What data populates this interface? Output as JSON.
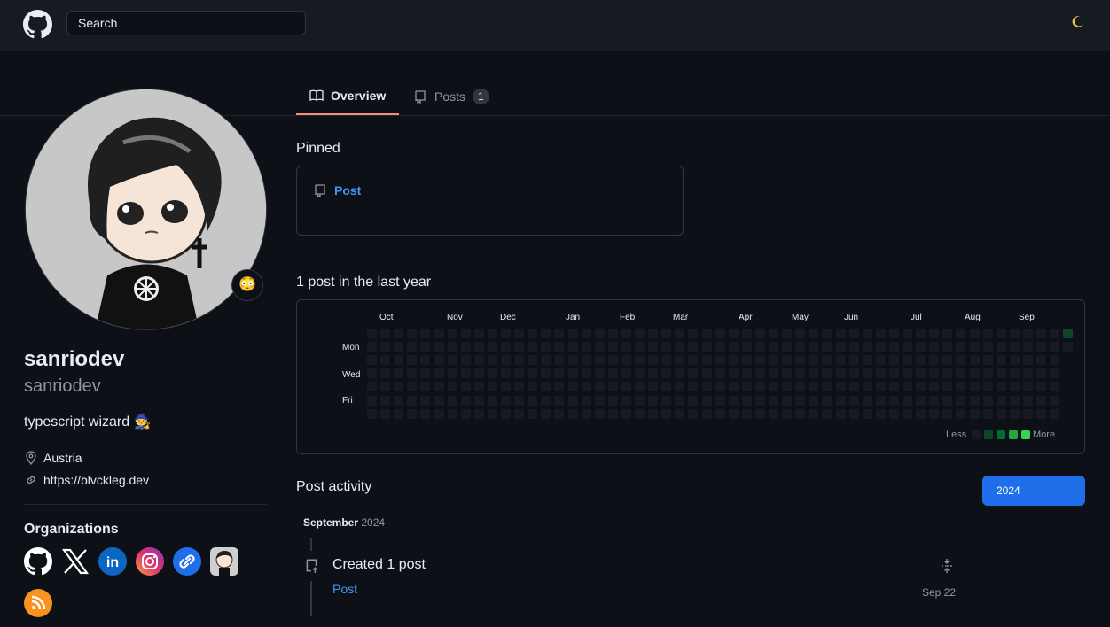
{
  "header": {
    "search_placeholder": "Search",
    "logo_icon": "github-mark-icon",
    "theme_icon": "moon-icon"
  },
  "tabs": [
    {
      "label": "Overview",
      "icon": "book-icon",
      "active": true
    },
    {
      "label": "Posts",
      "icon": "repo-icon",
      "count": "1",
      "active": false
    }
  ],
  "profile": {
    "name": "sanriodev",
    "login": "sanriodev",
    "bio": "typescript wizard 🧙",
    "status_emoji": "😳",
    "location": "Austria",
    "website": "https://blvckleg.dev"
  },
  "organizations": {
    "heading": "Organizations",
    "items": [
      {
        "name": "github",
        "icon": "github-icon"
      },
      {
        "name": "x",
        "icon": "x-icon"
      },
      {
        "name": "linkedin",
        "icon": "linkedin-icon"
      },
      {
        "name": "instagram",
        "icon": "instagram-icon"
      },
      {
        "name": "link",
        "icon": "link-icon"
      },
      {
        "name": "avatar",
        "icon": "avatar-icon"
      },
      {
        "name": "rss",
        "icon": "rss-icon"
      }
    ]
  },
  "pinned": {
    "heading": "Pinned",
    "items": [
      {
        "title": "Post"
      }
    ]
  },
  "contributions": {
    "heading": "1 post in the last year",
    "months": [
      "Oct",
      "Nov",
      "Dec",
      "Jan",
      "Feb",
      "Mar",
      "Apr",
      "May",
      "Jun",
      "Jul",
      "Aug",
      "Sep"
    ],
    "day_labels": [
      "Mon",
      "Wed",
      "Fri"
    ],
    "legend_less": "Less",
    "legend_more": "More",
    "colors": [
      "#161b22",
      "#0e4429",
      "#006d32",
      "#26a641",
      "#39d353"
    ],
    "weeks": 53,
    "active_cells": [
      {
        "week": 52,
        "day": 0,
        "level": 1
      }
    ]
  },
  "activity": {
    "heading": "Post activity",
    "year_button": "2024",
    "month": "September",
    "year": "2024",
    "summary": "Created 1 post",
    "post_title": "Post",
    "date": "Sep 22"
  }
}
